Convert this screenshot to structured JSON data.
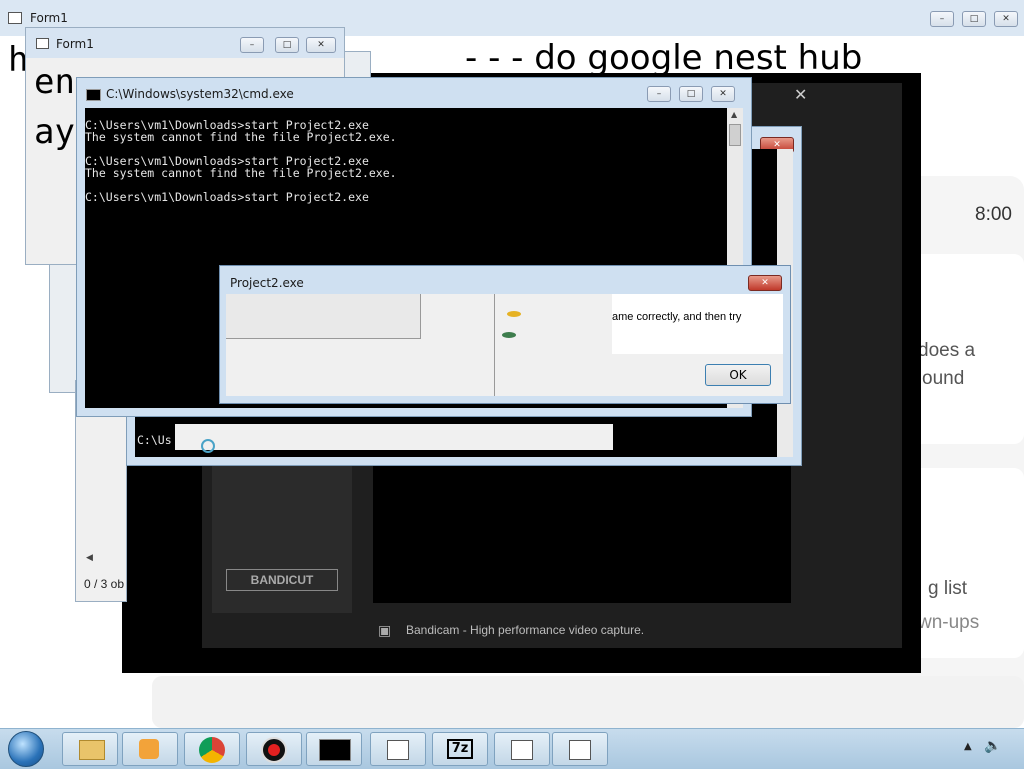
{
  "background_page": {
    "line1": "h",
    "line2": "en",
    "line3": "ay",
    "headline": "- - - do google nest hub",
    "time": "8:00",
    "side_text1": "does a",
    "side_text2": "ound",
    "side_text3": "g list",
    "side_text4": "wn-ups"
  },
  "form1_back": {
    "title": "Form1"
  },
  "form1_front": {
    "title": "Form1"
  },
  "explorer": {
    "status": "0 / 3 ob"
  },
  "cmd": {
    "title": "C:\\Windows\\system32\\cmd.exe",
    "lines": [
      "C:\\Users\\vm1\\Downloads>start Project2.exe",
      "The system cannot find the file Project2.exe.",
      "",
      "C:\\Users\\vm1\\Downloads>start Project2.exe",
      "The system cannot find the file Project2.exe.",
      "",
      "C:\\Users\\vm1\\Downloads>start Project2.exe"
    ]
  },
  "cmd_back": {
    "prompt": "C:\\Us"
  },
  "dialog": {
    "title": "Project2.exe",
    "message": "ame correctly, and then try",
    "ok": "OK"
  },
  "bandicam": {
    "logo": "BANDICUT",
    "status": "Bandicam - High performance video capture."
  },
  "taskbar": {
    "items": [
      "start-orb",
      "explorer-icon",
      "media-player-icon",
      "chrome-icon",
      "bandicam-icon",
      "cmd-icon",
      "folder-icon",
      "7zip-icon",
      "folder-icon",
      "folder-icon"
    ],
    "colors": {
      "taskbar": "#b8d1e5",
      "cmd_bg": "#000000",
      "dialog_bg": "#f0f0f0"
    }
  }
}
